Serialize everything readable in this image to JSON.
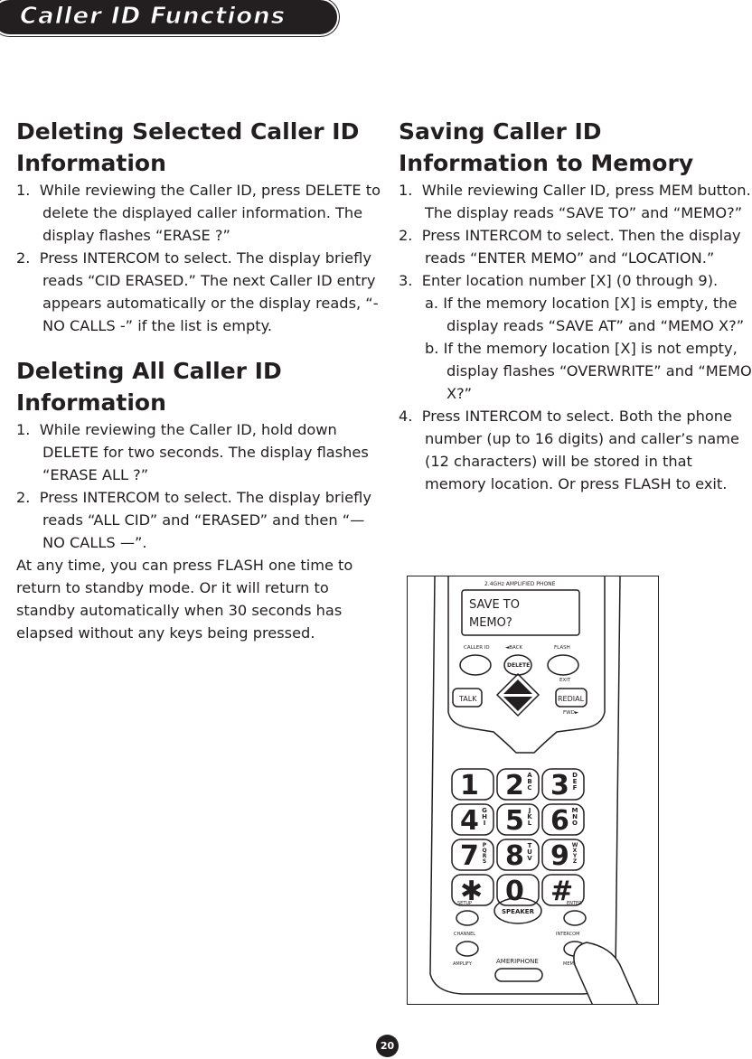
{
  "header": {
    "title": "Caller ID Functions"
  },
  "left": {
    "section1": {
      "title": "Deleting Selected Caller ID Information",
      "steps": [
        "1.  While reviewing the Caller ID, press DELETE to delete the displayed caller information. The display flashes “ERASE ?”",
        "2.  Press INTERCOM to select. The display briefly reads “CID ERASED.” The next Caller ID entry appears automatically or the display reads, “- NO CALLS -” if the list is empty."
      ]
    },
    "section2": {
      "title": "Deleting All Caller ID Information",
      "steps": [
        "1.  While reviewing the Caller ID, hold down DELETE for two seconds. The display flashes “ERASE ALL ?”",
        "2.  Press INTERCOM to select. The display briefly reads “ALL CID” and “ERASED” and then “— NO CALLS —”."
      ],
      "note": "At any time, you can press FLASH one time to return to standby mode. Or it will return to standby automatically when 30 seconds has elapsed without any keys being pressed."
    }
  },
  "right": {
    "section": {
      "title": "Saving Caller ID Information to Memory",
      "steps": [
        "1.  While reviewing Caller ID, press MEM button. The display reads “SAVE TO” and “MEMO?”",
        "2.  Press INTERCOM to select. Then the display reads “ENTER MEMO” and “LOCATION.”",
        "3.  Enter location number [X] (0 through 9)."
      ],
      "substeps": [
        "a. If the memory location [X] is empty, the display reads “SAVE AT” and “MEMO X?”",
        "b. If the memory location [X] is not empty, display flashes “OVERWRITE” and “MEMO X?”"
      ],
      "final_step": "4.  Press INTERCOM to select. Both the phone number (up to 16 digits) and caller’s name (12 characters) will be stored in that memory location. Or press FLASH to exit."
    }
  },
  "phone": {
    "brand_top": "2.4GHz AMPLIFIED PHONE",
    "display_line1": "SAVE TO",
    "display_line2": "MEMO?",
    "caller_id": "CALLER ID",
    "back": "◄BACK",
    "flash": "FLASH",
    "delete": "DELETE",
    "exit": "EXIT",
    "talk": "TALK",
    "redial": "REDIAL",
    "fwd": "FWD►",
    "keys": [
      {
        "d": "1",
        "l": ""
      },
      {
        "d": "2",
        "l": "ABC"
      },
      {
        "d": "3",
        "l": "DEF"
      },
      {
        "d": "4",
        "l": "GHI"
      },
      {
        "d": "5",
        "l": "JKL"
      },
      {
        "d": "6",
        "l": "MNO"
      },
      {
        "d": "7",
        "l": "PQRS"
      },
      {
        "d": "8",
        "l": "TUV"
      },
      {
        "d": "9",
        "l": "WXYZ"
      },
      {
        "d": "✱",
        "l": ""
      },
      {
        "d": "0",
        "l": ""
      },
      {
        "d": "#",
        "l": ""
      }
    ],
    "setup": "SETUP",
    "channel": "CHANNEL",
    "amplify": "AMPLIFY",
    "speaker": "SPEAKER",
    "enter": "ENTER",
    "intercom": "INTERCOM",
    "mem": "MEM",
    "brand": "AMERIPHONE"
  },
  "page_number": "20"
}
